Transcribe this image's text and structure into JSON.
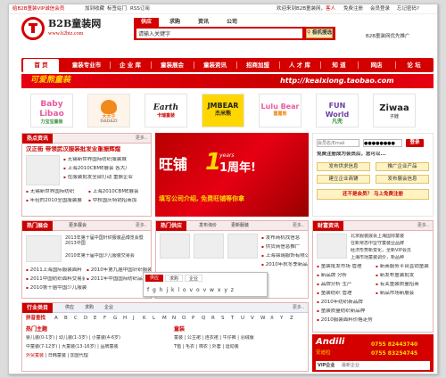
{
  "topbar": {
    "left_link": "给B2B童装VIP诚信会员",
    "links": [
      "加到收藏",
      "标签站门",
      "RSS订阅"
    ],
    "welcome": "欢迎来到B2B童装网，",
    "guest": "客人",
    "register": "免费注册",
    "login": "会员登录",
    "forgot": "忘记密码?"
  },
  "header": {
    "brand": "B2B童装网",
    "domain": "www.b2btz.com",
    "promo_link": "B2B童装网优先推广"
  },
  "search": {
    "tabs": [
      "供应",
      "求购",
      "资讯",
      "公司"
    ],
    "placeholder": "请输入关键字",
    "button": "极机搜选"
  },
  "nav": {
    "items": [
      "首 页",
      "童装专业市",
      "企 业 库",
      "童装展会",
      "童装资讯",
      "招商加盟",
      "人 才 库",
      "知 道",
      "网店",
      "论 坛"
    ]
  },
  "banner": {
    "brand": "可爱熊童装",
    "url": "http://keaixiong.taobao.com"
  },
  "brands": [
    {
      "name": "Baby Libao",
      "sub": "力宝宝童装"
    },
    {
      "name": "大大子",
      "sub": "DADAZI"
    },
    {
      "name": "Earth",
      "sub": "卡瑞童装"
    },
    {
      "name": "JMBEAR",
      "sub": "杰米熊"
    },
    {
      "name": "Lulu Bear",
      "sub": "露露熊"
    },
    {
      "name": "FUN World",
      "sub": "凡兜"
    },
    {
      "name": "Ziwaa",
      "sub": "子娃"
    }
  ],
  "hot": {
    "title": "热点资讯",
    "more": "更多..",
    "headline": "汉正街 带领武汉服装批发业重振辉煌",
    "items": [
      "无锡新世界国际纺织服装城",
      "上海2010CBME展会 各大厂",
      "在服装批发全部打动 重振企业",
      "无锡新世界国际纺织",
      "上海2010CBME展会",
      "年轻的2010全国服装展",
      "中秋国庆特销招商加"
    ]
  },
  "center": {
    "brand": "旺铺",
    "subtitle": "1周年!",
    "anniversary": "years",
    "caption": "填写公司介绍, 免费旺铺等你拿"
  },
  "member": {
    "email_label": "会员名/Email",
    "password": "●●●●●●●●",
    "login": "登录",
    "register_prompt": "免费注册成为会员后，您可以...",
    "actions": [
      "发布供求信息",
      "推广企业产品",
      "建立企业商铺",
      "发布展会信息"
    ],
    "cta": "还不是会员？ 马上免费注册"
  },
  "expo": {
    "title": "热门展会",
    "more": "更多..",
    "tab2": "更多展会",
    "items": [
      "2010年第九届中国针织服装",
      "2011上海国际服装面料",
      "2011中国纺织面料交易会",
      "2011年中国国际纺织品",
      "2010第十届中国少儿服装"
    ],
    "desc": [
      "2013年第十届中国针织服装品博览会暨2013中国",
      "2010年第十届中国少儿服装交易会"
    ]
  },
  "supply": {
    "title": "热门供应",
    "more": "更多..",
    "tabs": [
      "热销供应",
      "发布询价",
      "更新服装"
    ],
    "items": [
      "发布商机找信息",
      "供货商信息推广",
      "上海锦瑞服饰有限公司",
      "2010年秋冬季新品儿童服装"
    ]
  },
  "bizinfo": {
    "title": "财富资讯",
    "more": "更多..",
    "headline": "北京服装展会上海国际童装",
    "items": [
      "在新常态中坚守童装业品牌",
      "经济形势新变化，全新VIP会员",
      "上海市场童装调价，新品种",
      "童装批发市场 管理",
      "新品牌 分析",
      "品牌分析 生产",
      "童装纺织 管理"
    ],
    "news": [
      "新商服务平台直销童装",
      "新发布童装批发",
      "有关童装质量招商",
      "新品市场新展会",
      "2010年纺织新品牌",
      "童装质量纺织新品种",
      "2010服装面料价格走势"
    ]
  },
  "industry": {
    "title": "行业类目",
    "more": "更多..",
    "tabs": [
      "供应",
      "求购",
      "企业"
    ],
    "alpha_label": "拼音查找",
    "letters": [
      "A",
      "B",
      "C",
      "D",
      "E",
      "F",
      "G",
      "H",
      "J",
      "K",
      "L",
      "M",
      "N",
      "O",
      "P",
      "Q",
      "R",
      "S",
      "T",
      "U",
      "V",
      "W",
      "X",
      "Y",
      "Z"
    ],
    "hot_label": "热门主题",
    "cat2": "童装",
    "row1": [
      "婴儿装(0-1岁)",
      "幼儿装(1-3岁)",
      "小童装(4-6岁)"
    ],
    "row2": [
      "中童装(7-12岁)",
      "大童装(13-16岁)",
      "品牌童装"
    ],
    "row3": [
      "外贸童装",
      "日韩童装",
      "加盟代理"
    ],
    "row4": [
      "童装",
      "公主裙",
      "连衣裙",
      "牛仔裤",
      "羽绒服"
    ],
    "row5": [
      "T恤",
      "毛衣",
      "棉衣",
      "外套",
      "运动装"
    ]
  },
  "vip": {
    "title": "VIP企业",
    "tab2": "最新企业",
    "company": "爱迪尔童装",
    "brand": "Andili",
    "sub": "安迪拉",
    "phone1": "0755 82443740",
    "phone2": "0755 83254745",
    "footer": "一诚信品牌服装有限公司"
  },
  "popup": {
    "title": "供应",
    "tab2": "求购",
    "tab3": "企业",
    "letters": "f g h j k l o v o v w x y z"
  }
}
